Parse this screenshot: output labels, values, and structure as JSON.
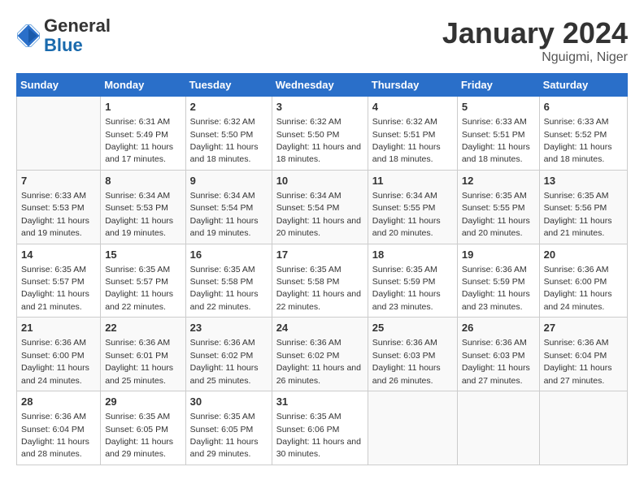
{
  "logo": {
    "general": "General",
    "blue": "Blue"
  },
  "title": "January 2024",
  "location": "Nguigmi, Niger",
  "days_header": [
    "Sunday",
    "Monday",
    "Tuesday",
    "Wednesday",
    "Thursday",
    "Friday",
    "Saturday"
  ],
  "weeks": [
    [
      {
        "num": "",
        "sunrise": "",
        "sunset": "",
        "daylight": ""
      },
      {
        "num": "1",
        "sunrise": "Sunrise: 6:31 AM",
        "sunset": "Sunset: 5:49 PM",
        "daylight": "Daylight: 11 hours and 17 minutes."
      },
      {
        "num": "2",
        "sunrise": "Sunrise: 6:32 AM",
        "sunset": "Sunset: 5:50 PM",
        "daylight": "Daylight: 11 hours and 18 minutes."
      },
      {
        "num": "3",
        "sunrise": "Sunrise: 6:32 AM",
        "sunset": "Sunset: 5:50 PM",
        "daylight": "Daylight: 11 hours and 18 minutes."
      },
      {
        "num": "4",
        "sunrise": "Sunrise: 6:32 AM",
        "sunset": "Sunset: 5:51 PM",
        "daylight": "Daylight: 11 hours and 18 minutes."
      },
      {
        "num": "5",
        "sunrise": "Sunrise: 6:33 AM",
        "sunset": "Sunset: 5:51 PM",
        "daylight": "Daylight: 11 hours and 18 minutes."
      },
      {
        "num": "6",
        "sunrise": "Sunrise: 6:33 AM",
        "sunset": "Sunset: 5:52 PM",
        "daylight": "Daylight: 11 hours and 18 minutes."
      }
    ],
    [
      {
        "num": "7",
        "sunrise": "Sunrise: 6:33 AM",
        "sunset": "Sunset: 5:53 PM",
        "daylight": "Daylight: 11 hours and 19 minutes."
      },
      {
        "num": "8",
        "sunrise": "Sunrise: 6:34 AM",
        "sunset": "Sunset: 5:53 PM",
        "daylight": "Daylight: 11 hours and 19 minutes."
      },
      {
        "num": "9",
        "sunrise": "Sunrise: 6:34 AM",
        "sunset": "Sunset: 5:54 PM",
        "daylight": "Daylight: 11 hours and 19 minutes."
      },
      {
        "num": "10",
        "sunrise": "Sunrise: 6:34 AM",
        "sunset": "Sunset: 5:54 PM",
        "daylight": "Daylight: 11 hours and 20 minutes."
      },
      {
        "num": "11",
        "sunrise": "Sunrise: 6:34 AM",
        "sunset": "Sunset: 5:55 PM",
        "daylight": "Daylight: 11 hours and 20 minutes."
      },
      {
        "num": "12",
        "sunrise": "Sunrise: 6:35 AM",
        "sunset": "Sunset: 5:55 PM",
        "daylight": "Daylight: 11 hours and 20 minutes."
      },
      {
        "num": "13",
        "sunrise": "Sunrise: 6:35 AM",
        "sunset": "Sunset: 5:56 PM",
        "daylight": "Daylight: 11 hours and 21 minutes."
      }
    ],
    [
      {
        "num": "14",
        "sunrise": "Sunrise: 6:35 AM",
        "sunset": "Sunset: 5:57 PM",
        "daylight": "Daylight: 11 hours and 21 minutes."
      },
      {
        "num": "15",
        "sunrise": "Sunrise: 6:35 AM",
        "sunset": "Sunset: 5:57 PM",
        "daylight": "Daylight: 11 hours and 22 minutes."
      },
      {
        "num": "16",
        "sunrise": "Sunrise: 6:35 AM",
        "sunset": "Sunset: 5:58 PM",
        "daylight": "Daylight: 11 hours and 22 minutes."
      },
      {
        "num": "17",
        "sunrise": "Sunrise: 6:35 AM",
        "sunset": "Sunset: 5:58 PM",
        "daylight": "Daylight: 11 hours and 22 minutes."
      },
      {
        "num": "18",
        "sunrise": "Sunrise: 6:35 AM",
        "sunset": "Sunset: 5:59 PM",
        "daylight": "Daylight: 11 hours and 23 minutes."
      },
      {
        "num": "19",
        "sunrise": "Sunrise: 6:36 AM",
        "sunset": "Sunset: 5:59 PM",
        "daylight": "Daylight: 11 hours and 23 minutes."
      },
      {
        "num": "20",
        "sunrise": "Sunrise: 6:36 AM",
        "sunset": "Sunset: 6:00 PM",
        "daylight": "Daylight: 11 hours and 24 minutes."
      }
    ],
    [
      {
        "num": "21",
        "sunrise": "Sunrise: 6:36 AM",
        "sunset": "Sunset: 6:00 PM",
        "daylight": "Daylight: 11 hours and 24 minutes."
      },
      {
        "num": "22",
        "sunrise": "Sunrise: 6:36 AM",
        "sunset": "Sunset: 6:01 PM",
        "daylight": "Daylight: 11 hours and 25 minutes."
      },
      {
        "num": "23",
        "sunrise": "Sunrise: 6:36 AM",
        "sunset": "Sunset: 6:02 PM",
        "daylight": "Daylight: 11 hours and 25 minutes."
      },
      {
        "num": "24",
        "sunrise": "Sunrise: 6:36 AM",
        "sunset": "Sunset: 6:02 PM",
        "daylight": "Daylight: 11 hours and 26 minutes."
      },
      {
        "num": "25",
        "sunrise": "Sunrise: 6:36 AM",
        "sunset": "Sunset: 6:03 PM",
        "daylight": "Daylight: 11 hours and 26 minutes."
      },
      {
        "num": "26",
        "sunrise": "Sunrise: 6:36 AM",
        "sunset": "Sunset: 6:03 PM",
        "daylight": "Daylight: 11 hours and 27 minutes."
      },
      {
        "num": "27",
        "sunrise": "Sunrise: 6:36 AM",
        "sunset": "Sunset: 6:04 PM",
        "daylight": "Daylight: 11 hours and 27 minutes."
      }
    ],
    [
      {
        "num": "28",
        "sunrise": "Sunrise: 6:36 AM",
        "sunset": "Sunset: 6:04 PM",
        "daylight": "Daylight: 11 hours and 28 minutes."
      },
      {
        "num": "29",
        "sunrise": "Sunrise: 6:35 AM",
        "sunset": "Sunset: 6:05 PM",
        "daylight": "Daylight: 11 hours and 29 minutes."
      },
      {
        "num": "30",
        "sunrise": "Sunrise: 6:35 AM",
        "sunset": "Sunset: 6:05 PM",
        "daylight": "Daylight: 11 hours and 29 minutes."
      },
      {
        "num": "31",
        "sunrise": "Sunrise: 6:35 AM",
        "sunset": "Sunset: 6:06 PM",
        "daylight": "Daylight: 11 hours and 30 minutes."
      },
      {
        "num": "",
        "sunrise": "",
        "sunset": "",
        "daylight": ""
      },
      {
        "num": "",
        "sunrise": "",
        "sunset": "",
        "daylight": ""
      },
      {
        "num": "",
        "sunrise": "",
        "sunset": "",
        "daylight": ""
      }
    ]
  ]
}
